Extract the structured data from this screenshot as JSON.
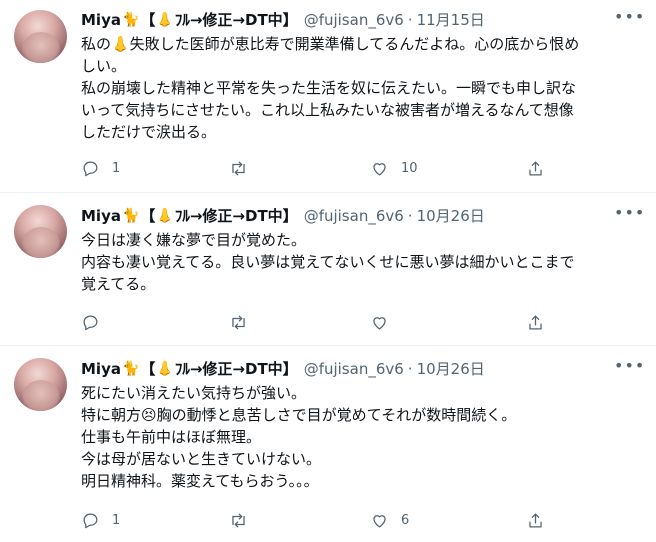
{
  "tweets": [
    {
      "author": "Miya",
      "name_suffix": "【",
      "name_rest": "ﾌﾙ→修正→DT中】",
      "handle": "@fujisan_6v6",
      "dot": "·",
      "date": "11月15日",
      "lines": [
        "私の👃失敗した医師が恵比寿で開業準備してるんだよね。心の底から恨め",
        "しい。",
        "私の崩壊した精神と平常を失った生活を奴に伝えたい。一瞬でも申し訳な",
        "いって気持ちにさせたい。これ以上私みたいな被害者が増えるなんて想像",
        "しただけで涙出る。"
      ],
      "replies": "1",
      "retweets": "",
      "likes": "10"
    },
    {
      "author": "Miya",
      "name_suffix": "【",
      "name_rest": "ﾌﾙ→修正→DT中】",
      "handle": "@fujisan_6v6",
      "dot": "·",
      "date": "10月26日",
      "lines": [
        "今日は凄く嫌な夢で目が覚めた。",
        "内容も凄い覚えてる。良い夢は覚えてないくせに悪い夢は細かいとこまで",
        "覚えてる。"
      ],
      "replies": "",
      "retweets": "",
      "likes": ""
    },
    {
      "author": "Miya",
      "name_suffix": "【",
      "name_rest": "ﾌﾙ→修正→DT中】",
      "handle": "@fujisan_6v6",
      "dot": "·",
      "date": "10月26日",
      "lines": [
        "死にたい消えたい気持ちが強い。",
        "特に朝方😣胸の動悸と息苦しさで目が覚めてそれが数時間続く。",
        "仕事も午前中はほぼ無理。",
        "今は母が居ないと生きていけない。",
        "明日精神科。薬変えてもらおう。。。"
      ],
      "replies": "1",
      "retweets": "",
      "likes": "6"
    }
  ],
  "icons": {
    "author_badge": "cat-emoji",
    "name_badge": "nose-emoji",
    "more": "more-dots-icon",
    "reply": "reply-icon",
    "retweet": "retweet-icon",
    "like": "heart-icon",
    "share": "share-icon"
  }
}
